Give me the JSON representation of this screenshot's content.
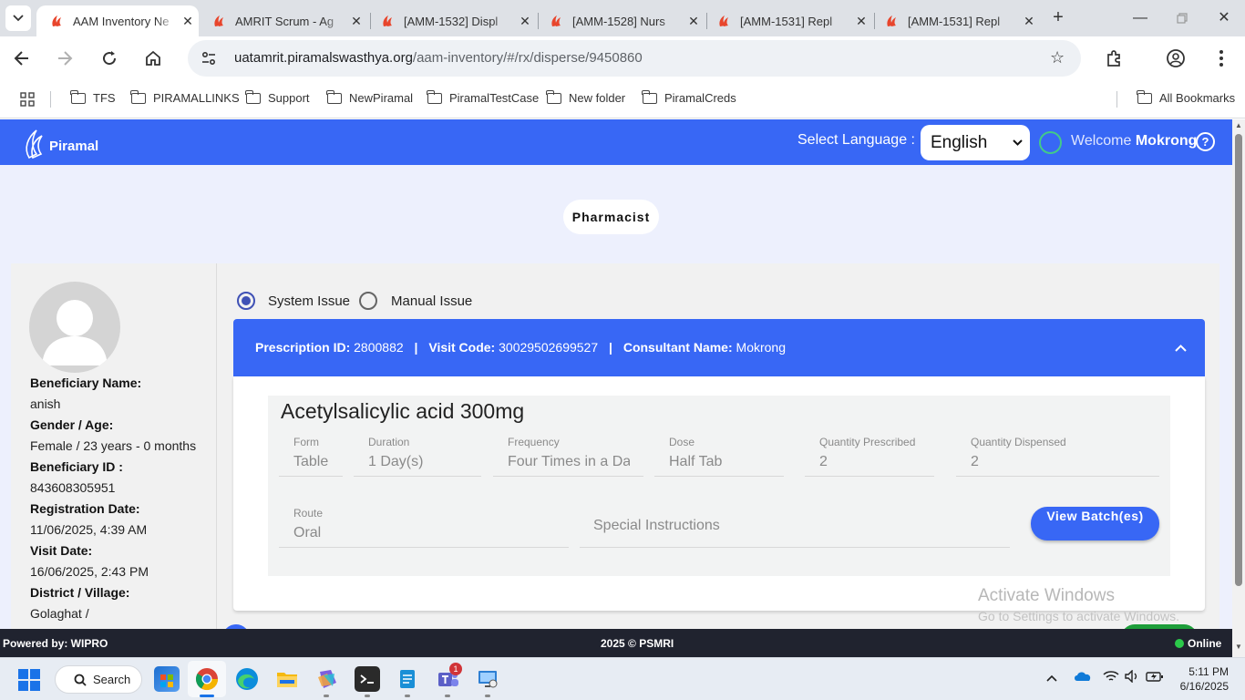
{
  "browser": {
    "tabs": [
      {
        "label": "AAM Inventory Ne",
        "active": true
      },
      {
        "label": "AMRIT Scrum - Ag",
        "active": false
      },
      {
        "label": "[AMM-1532] Displ",
        "active": false
      },
      {
        "label": "[AMM-1528] Nurs",
        "active": false
      },
      {
        "label": "[AMM-1531] Repl",
        "active": false
      },
      {
        "label": "[AMM-1531] Repl",
        "active": false
      }
    ],
    "url_domain": "uatamrit.piramalswasthya.org",
    "url_path": "/aam-inventory/#/rx/disperse/9450860",
    "bookmarks": [
      "TFS",
      "PIRAMALLINKS",
      "Support",
      "NewPiramal",
      "PiramalTestCase",
      "New folder",
      "PiramalCreds"
    ],
    "all_bookmarks": "All Bookmarks"
  },
  "app": {
    "logo_text": "Piramal",
    "select_language_label": "Select Language :",
    "language": "English",
    "welcome_prefix": "Welcome",
    "user_name": "Mokrong",
    "help_glyph": "?",
    "role": "Pharmacist",
    "brand_color": "#3867f5"
  },
  "beneficiary": {
    "name_label": "Beneficiary Name:",
    "name": "anish",
    "gender_age_label": "Gender / Age:",
    "gender_age": "Female / 23 years - 0 months",
    "id_label": "Beneficiary ID :",
    "id": "843608305951",
    "reg_date_label": "Registration Date:",
    "reg_date": "11/06/2025, 4:39 AM",
    "visit_date_label": "Visit Date:",
    "visit_date": "16/06/2025, 2:43 PM",
    "district_label": "District / Village:",
    "district": "Golaghat /"
  },
  "issue": {
    "system_label": "System Issue",
    "manual_label": "Manual Issue",
    "selected": "System Issue"
  },
  "prescription": {
    "id_label": "Prescription ID:",
    "id": "2800882",
    "visit_code_label": "Visit Code:",
    "visit_code": "30029502699527",
    "consultant_label": "Consultant Name:",
    "consultant": "Mokrong",
    "separator": "|",
    "drug": {
      "name": "Acetylsalicylic acid 300mg",
      "form_label": "Form",
      "form": "Table",
      "duration_label": "Duration",
      "duration": "1 Day(s)",
      "frequency_label": "Frequency",
      "frequency": "Four Times in a Day",
      "dose_label": "Dose",
      "dose": "Half Tab",
      "qty_prescribed_label": "Quantity Prescribed",
      "qty_prescribed": "2",
      "qty_dispensed_label": "Quantity Dispensed",
      "qty_dispensed": "2",
      "route_label": "Route",
      "route": "Oral",
      "special_instructions_placeholder": "Special Instructions",
      "view_batch_label": "View Batch(es)"
    }
  },
  "watermark": {
    "line1": "Activate Windows",
    "line2": "Go to Settings to activate Windows."
  },
  "footer": {
    "powered_by": "Powered by: WIPRO",
    "copyright": "2025 © PSMRI",
    "status": "Online"
  },
  "taskbar": {
    "search_label": "Search",
    "teams_badge": "1",
    "time": "5:11 PM",
    "date": "6/16/2025"
  }
}
